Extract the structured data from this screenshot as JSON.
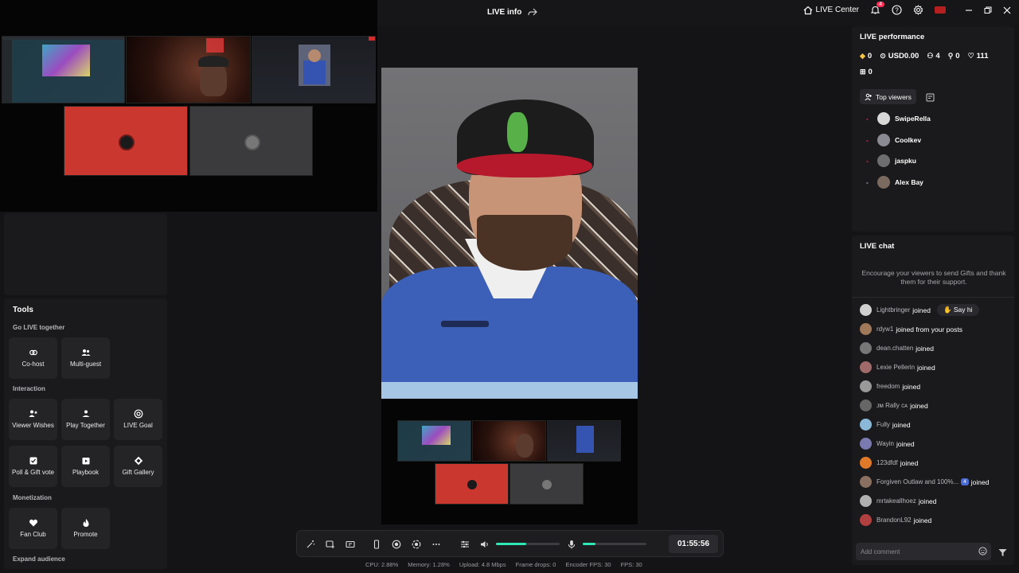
{
  "topbar": {
    "live_info": "LIVE info",
    "live_center": "LIVE Center",
    "notif_count": "4"
  },
  "tools": {
    "title": "Tools",
    "sections": {
      "go_live": "Go LIVE together",
      "interaction": "Interaction",
      "monetization": "Monetization",
      "expand": "Expand audience"
    },
    "items": {
      "cohost": "Co-host",
      "multiguest": "Multi-guest",
      "viewer_wishes": "Viewer Wishes",
      "play_together": "Play Together",
      "live_goal": "LIVE Goal",
      "poll_gift": "Poll & Gift vote",
      "playbook": "Playbook",
      "gift_gallery": "Gift Gallery",
      "fan_club": "Fan Club",
      "promote": "Promote"
    }
  },
  "controls": {
    "timer": "01:55:56",
    "speaker_level": 0.48,
    "mic_level": 0.2
  },
  "stats": {
    "cpu": "CPU:  2.88%",
    "memory": "Memory:  1.28%",
    "upload": "Upload:  4.8 Mbps",
    "frame_drops": "Frame drops:  0",
    "encoder_fps": "Encoder FPS:  30",
    "fps": "FPS:  30"
  },
  "performance": {
    "title": "LIVE performance",
    "diamonds": "0",
    "usd": "USD0.00",
    "viewers": "4",
    "new_followers": "0",
    "likes": "111",
    "gifts": "0",
    "top_viewers_label": "Top viewers",
    "top_viewers": [
      {
        "rank": "-",
        "name": "SwipeRella",
        "color": "#d8d8d8"
      },
      {
        "rank": "-",
        "name": "Coolkev",
        "color": "#8a8a92"
      },
      {
        "rank": "-",
        "name": "jaspku",
        "color": "#6e6e70"
      },
      {
        "rank": "-",
        "name": "Alex Bay",
        "color": "#7a6a60"
      }
    ]
  },
  "chat": {
    "title": "LIVE chat",
    "hint": "Encourage your viewers to send Gifts and thank them for their support.",
    "say_hi": "Say hi",
    "input_placeholder": "Add comment",
    "messages": [
      {
        "name": "Lightbringer",
        "action": "joined",
        "color": "#cfcfcf"
      },
      {
        "name": "rdyw1",
        "action": "joined from your posts",
        "color": "#a0785a"
      },
      {
        "name": "dean.chatten",
        "action": "joined",
        "color": "#777"
      },
      {
        "name": "Lexie Pellerin",
        "action": "joined",
        "color": "#a06a6a"
      },
      {
        "name": "freedom",
        "action": "joined",
        "color": "#999"
      },
      {
        "name": "ᴊᴍ Rally ᴄᴀ",
        "action": "joined",
        "color": "#666"
      },
      {
        "name": "Fully",
        "action": "joined",
        "color": "#8bb8d6"
      },
      {
        "name": "Wayin",
        "action": "joined",
        "color": "#7a7ab0"
      },
      {
        "name": "123dfdf",
        "action": "joined",
        "color": "#e07a2a"
      },
      {
        "name": "Forgiven Outlaw and 100%...",
        "action": "joined",
        "color": "#8a7060",
        "level": "4"
      },
      {
        "name": "mrtakeallhoez",
        "action": "joined",
        "color": "#b0b0b0"
      },
      {
        "name": "BrandonL92",
        "action": "joined",
        "color": "#b04040"
      }
    ]
  }
}
